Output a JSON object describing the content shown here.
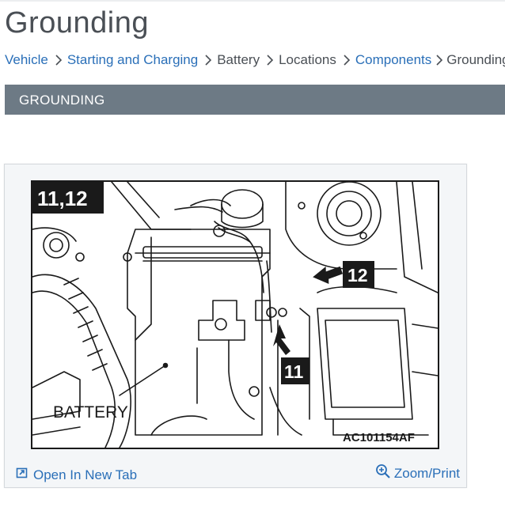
{
  "page": {
    "title": "Grounding"
  },
  "breadcrumb": [
    {
      "label": "Vehicle",
      "link": true
    },
    {
      "label": "Starting and Charging",
      "link": true
    },
    {
      "label": "Battery",
      "link": false
    },
    {
      "label": "Locations",
      "link": false
    },
    {
      "label": "Components",
      "link": true
    },
    {
      "label": "Grounding",
      "link": false
    }
  ],
  "section": {
    "heading": "GROUNDING"
  },
  "figure": {
    "view_label": "11,12",
    "callout_12": "12",
    "callout_11": "11",
    "battery_label": "BATTERY",
    "figure_code": "AC101154AF"
  },
  "actions": {
    "open_new_tab": "Open In New Tab",
    "zoom_print": "Zoom/Print"
  },
  "colors": {
    "link": "#2a6fb8",
    "banner": "#6d7a85",
    "title_text": "#4a4f55"
  },
  "icons": {
    "breadcrumb_separator": "chevron-right-icon",
    "open_tab": "open-external-icon",
    "zoom": "zoom-in-icon"
  }
}
